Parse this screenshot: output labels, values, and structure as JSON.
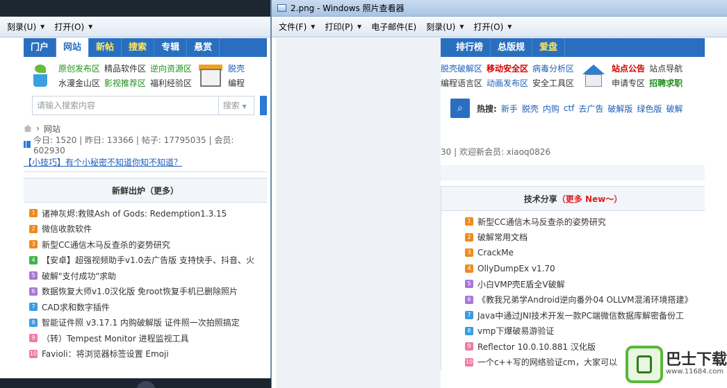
{
  "left_window": {
    "menu": [
      {
        "label": "刻录(U)"
      },
      {
        "label": "打开(O)"
      }
    ],
    "navbar": [
      {
        "label": "门户",
        "state": "normal"
      },
      {
        "label": "网站",
        "state": "active"
      },
      {
        "label": "新帖",
        "state": "hot"
      },
      {
        "label": "搜索",
        "state": "hot"
      },
      {
        "label": "专辑",
        "state": "normal"
      },
      {
        "label": "悬赏",
        "state": "normal"
      }
    ],
    "zones": {
      "row1": [
        "原创发布区",
        "精品软件区",
        "逆向资源区"
      ],
      "row2": [
        "水漫金山区",
        "影视推荐区",
        "福利经验区"
      ],
      "trail1": "脱壳",
      "trail2": "编程"
    },
    "search": {
      "placeholder": "请输入搜索内容",
      "select": "搜索"
    },
    "breadcrumb": "网站",
    "stats": "今日: 1520 | 昨日: 13366 | 帖子: 17795035 | 会员: 602930",
    "tip": "【小技巧】有个小秘密不知道你知不知道？",
    "panel_title": "新鲜出炉",
    "panel_more": "（更多）",
    "topics": [
      {
        "num": "1",
        "color": "orange",
        "title": "诸神灰烬:救赎Ash of Gods: Redemption1.3.15"
      },
      {
        "num": "2",
        "color": "orange",
        "title": "微信收款软件"
      },
      {
        "num": "3",
        "color": "orange",
        "title": "新型CC通信木马反查杀的姿势研究"
      },
      {
        "num": "4",
        "color": "green",
        "title": "【安卓】超强视频助手v1.0去广告版 支持快手、抖音、火"
      },
      {
        "num": "5",
        "color": "purple",
        "title": "破解\"支付成功\"求助"
      },
      {
        "num": "6",
        "color": "purple",
        "title": "数据恢复大师v1.0汉化版 免root恢复手机已删除照片"
      },
      {
        "num": "7",
        "color": "blue",
        "title": "CAD求和数字插件"
      },
      {
        "num": "8",
        "color": "blue",
        "title": "智能证件照 v3.17.1 内购破解版 证件照一次拍照搞定"
      },
      {
        "num": "9",
        "color": "pink",
        "title": "（转）Tempest Monitor 进程监视工具"
      },
      {
        "num": "10",
        "color": "pink",
        "title": "Favioli：将浏览器标签设置 Emoji"
      }
    ]
  },
  "right_window": {
    "title": "2.png - Windows 照片查看器",
    "menu": [
      {
        "label": "文件(F)"
      },
      {
        "label": "打印(P)"
      },
      {
        "label": "电子邮件(E)"
      },
      {
        "label": "刻录(U)"
      },
      {
        "label": "打开(O)"
      }
    ],
    "navbar": [
      {
        "label": "排行榜",
        "state": "normal"
      },
      {
        "label": "总版规",
        "state": "normal"
      },
      {
        "label": "爱盘",
        "state": "hot"
      }
    ],
    "zones": {
      "row1": [
        "脱壳破解区",
        "移动安全区",
        "病毒分析区"
      ],
      "row2": [
        "编程语言区",
        "动画发布区",
        "安全工具区"
      ],
      "side_row1": [
        "站点公告",
        "站点导航"
      ],
      "side_row2": [
        "申请专区",
        "招聘求职"
      ]
    },
    "hot": {
      "label": "热搜:",
      "keywords": [
        "新手",
        "脱壳",
        "内购",
        "ctf",
        "去广告",
        "破解版",
        "绿色版",
        "破解"
      ]
    },
    "stats_tail": "30 | 欢迎新会员: xiaoq0826",
    "left_overflow_char": "火",
    "panel_title": "技术分享",
    "panel_more": "（更多 New～）",
    "topics": [
      {
        "num": "1",
        "color": "orange",
        "title": "新型CC通信木马反查杀的姿势研究"
      },
      {
        "num": "2",
        "color": "orange",
        "title": "破解常用文档"
      },
      {
        "num": "3",
        "color": "orange",
        "title": "CrackMe"
      },
      {
        "num": "4",
        "color": "orange",
        "title": "OllyDumpEx v1.70"
      },
      {
        "num": "5",
        "color": "purple",
        "title": "小白VMP壳E盾全V破解"
      },
      {
        "num": "6",
        "color": "purple",
        "title": "《教我兄弟学Android逆向番外04 OLLVM混淆环境搭建》"
      },
      {
        "num": "7",
        "color": "blue",
        "title": "Java中通过JNI技术开发一款PC端微信数据库解密备份工"
      },
      {
        "num": "8",
        "color": "blue",
        "title": "vmp下爆破易游验证"
      },
      {
        "num": "9",
        "color": "pink",
        "title": "Reflector 10.0.10.881 汉化版"
      },
      {
        "num": "10",
        "color": "pink",
        "title": "一个c++写的网络验证cm，大家可以"
      }
    ]
  },
  "watermark": {
    "text": "巴士下载",
    "url": "www.11684.com"
  }
}
